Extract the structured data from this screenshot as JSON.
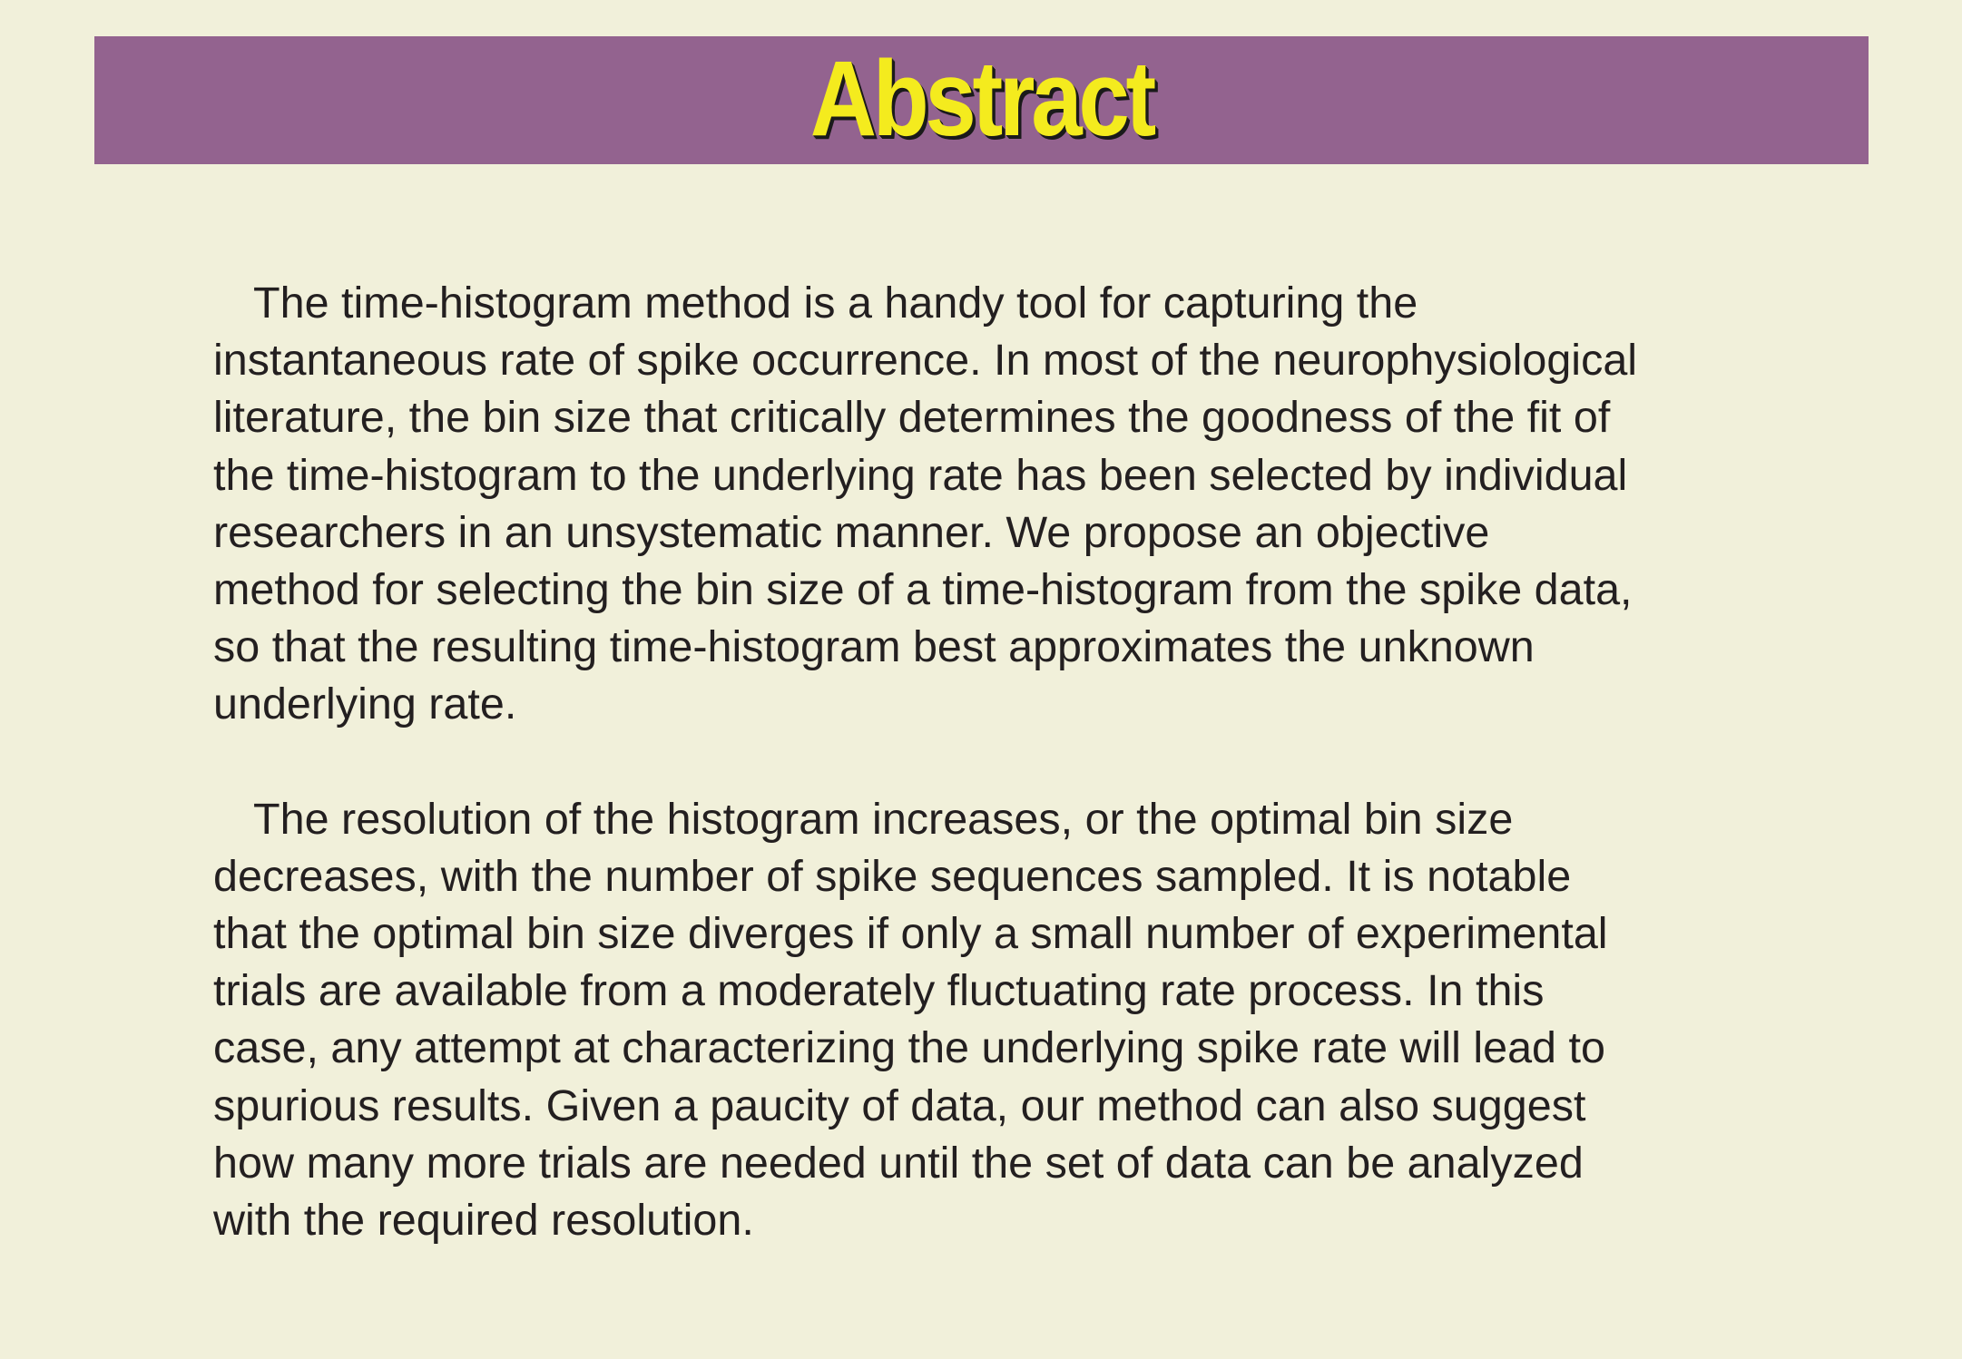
{
  "header": {
    "title": "Abstract"
  },
  "paragraphs": [
    "The time-histogram method is a handy tool for capturing the\ninstantaneous rate of spike occurrence. In most of the neurophysiological\nliterature, the bin size that critically determines the goodness of the fit of\nthe time-histogram to the underlying rate has been selected by individual\nresearchers in an unsystematic manner. We propose an objective\nmethod for selecting the bin size of a time-histogram from the spike data,\nso that the resulting time-histogram best approximates the unknown\nunderlying rate.",
    "The resolution of the histogram increases, or the optimal bin size\ndecreases, with the number of spike sequences sampled. It is notable\nthat the optimal bin size diverges if only a small number of experimental\ntrials are available from a moderately fluctuating rate process. In this\ncase, any attempt at characterizing the underlying spike rate will lead to\nspurious results. Given a paucity of data, our method can also suggest\nhow many more trials are needed until the set of data can be analyzed\nwith the required resolution."
  ],
  "colors": {
    "background": "#f1f0da",
    "header_band": "#93638f",
    "title_fill": "#f4eb1e",
    "title_shadow": "#1a1a1a",
    "body_text": "#231f20"
  }
}
